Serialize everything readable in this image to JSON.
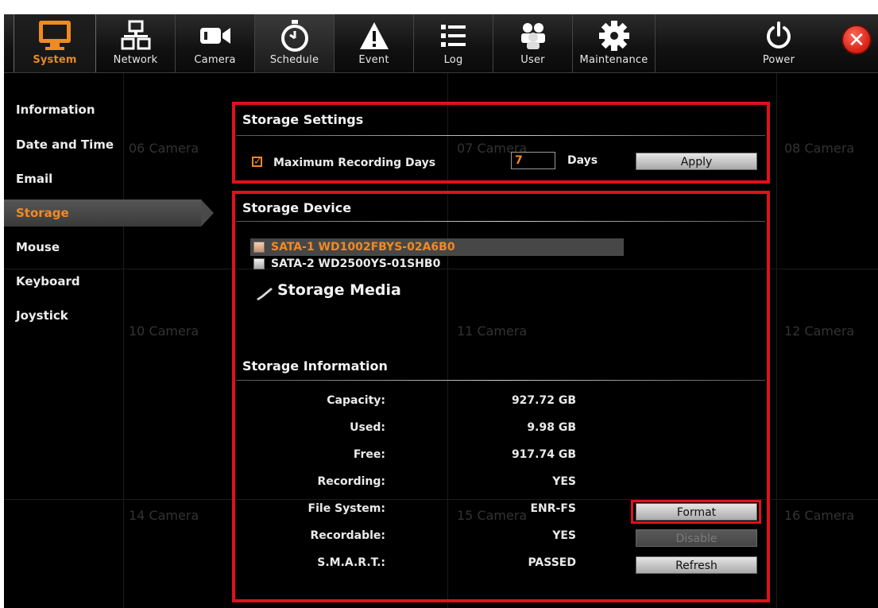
{
  "toolbar": {
    "items": [
      {
        "label": "System",
        "icon": "monitor-icon"
      },
      {
        "label": "Network",
        "icon": "network-icon"
      },
      {
        "label": "Camera",
        "icon": "camera-icon"
      },
      {
        "label": "Schedule",
        "icon": "stopwatch-icon"
      },
      {
        "label": "Event",
        "icon": "warning-icon"
      },
      {
        "label": "Log",
        "icon": "list-icon"
      },
      {
        "label": "User",
        "icon": "users-icon"
      },
      {
        "label": "Maintenance",
        "icon": "gear-icon"
      },
      {
        "label": "Power",
        "icon": "power-icon"
      }
    ],
    "close_glyph": "✕"
  },
  "cameras": {
    "c06": "06 Camera",
    "c07": "07 Camera",
    "c08": "08 Camera",
    "c10": "10 Camera",
    "c11": "11 Camera",
    "c12": "12 Camera",
    "c14": "14 Camera",
    "c15": "15 Camera",
    "c16": "16 Camera"
  },
  "sidebar": {
    "items": [
      {
        "label": "Information"
      },
      {
        "label": "Date and Time"
      },
      {
        "label": "Email"
      },
      {
        "label": "Storage"
      },
      {
        "label": "Mouse"
      },
      {
        "label": "Keyboard"
      },
      {
        "label": "Joystick"
      }
    ]
  },
  "storage_settings": {
    "title": "Storage Settings",
    "max_days_label": "Maximum Recording Days",
    "max_days_checked_glyph": "✓",
    "max_days_value": "7",
    "days_unit": "Days",
    "apply_label": "Apply"
  },
  "storage_device": {
    "title": "Storage Device",
    "devices": [
      {
        "name": "SATA-1 WD1002FBYS-02A6B0"
      },
      {
        "name": "SATA-2 WD2500YS-01SHB0"
      }
    ],
    "media_label": "Storage Media"
  },
  "storage_info": {
    "title": "Storage Information",
    "rows": [
      {
        "label": "Capacity:",
        "value": "927.72 GB"
      },
      {
        "label": "Used:",
        "value": "9.98 GB"
      },
      {
        "label": "Free:",
        "value": "917.74 GB"
      },
      {
        "label": "Recording:",
        "value": "YES"
      },
      {
        "label": "File System:",
        "value": "ENR-FS"
      },
      {
        "label": "Recordable:",
        "value": "YES"
      },
      {
        "label": "S.M.A.R.T.:",
        "value": "PASSED"
      }
    ],
    "format_label": "Format",
    "disable_label": "Disable",
    "refresh_label": "Refresh"
  },
  "colors": {
    "accent": "#e88a22",
    "highlight_box": "#e0111b"
  }
}
